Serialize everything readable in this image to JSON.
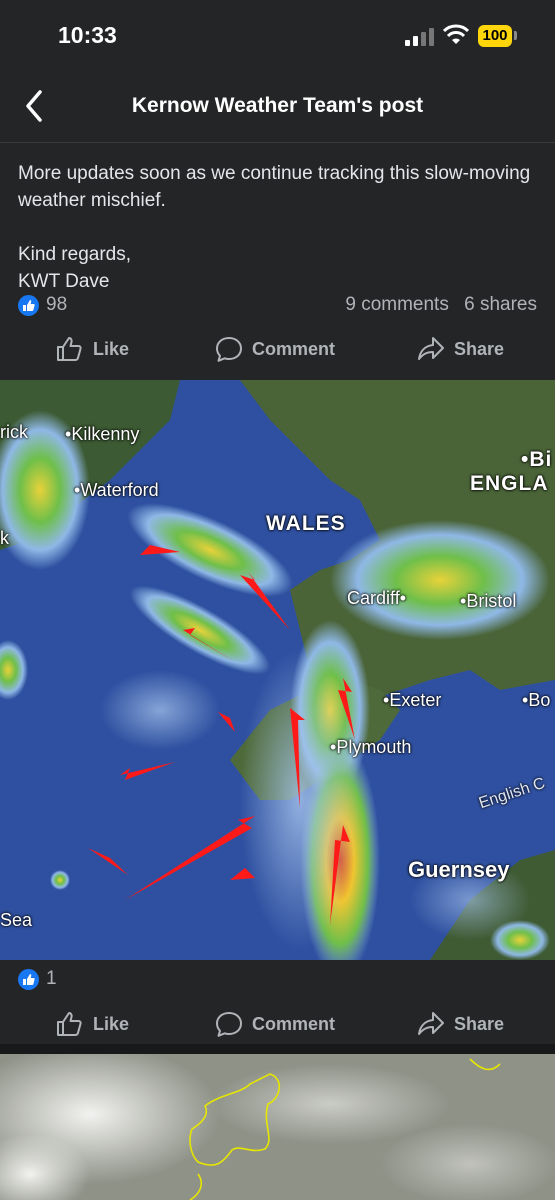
{
  "status_bar": {
    "time": "10:33",
    "battery": "100"
  },
  "nav": {
    "title": "Kernow Weather Team's post"
  },
  "post": {
    "lines": [
      "More updates soon as we continue tracking this slow-moving weather mischief."
    ],
    "sign_off": "Kind regards,",
    "signature": "KWT Dave",
    "like_count": "98",
    "comments": "9 comments",
    "shares": "6 shares"
  },
  "actions": {
    "like": "Like",
    "comment": "Comment",
    "share": "Share"
  },
  "map": {
    "labels": {
      "rick": "rick",
      "kilkenny": "Kilkenny",
      "waterford": "Waterford",
      "k": "k",
      "wales": "WALES",
      "england": "ENGLA",
      "bi": "Bi",
      "cardiff": "Cardiff",
      "bristol": "Bristol",
      "exeter": "Exeter",
      "bo": "Bo",
      "plymouth": "Plymouth",
      "english_channel": "English C",
      "guernsey": "Guernsey",
      "sea": "Sea"
    }
  },
  "photo1": {
    "like_count": "1"
  },
  "colors": {
    "background": "#242526",
    "accent": "#1877f2",
    "battery": "#ffd60a",
    "arrow": "#ff1a1a"
  }
}
